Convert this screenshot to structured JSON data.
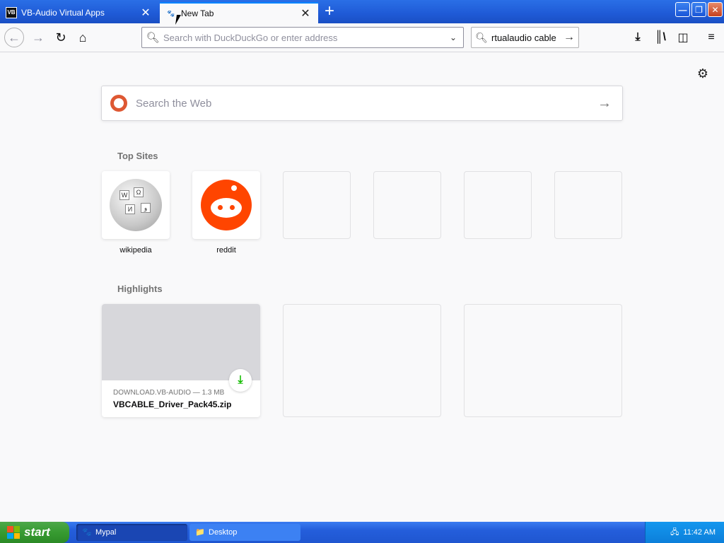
{
  "tabs": [
    {
      "title": "VB-Audio Virtual Apps",
      "favicon": "VB"
    },
    {
      "title": "New Tab"
    }
  ],
  "window_controls": {
    "minimize": "—",
    "restore": "❐",
    "close": "✕"
  },
  "navbar": {
    "url_placeholder": "Search with DuckDuckGo or enter address",
    "search_text": "rtualaudio cable"
  },
  "newtab": {
    "search_placeholder": "Search the Web",
    "top_sites_title": "Top Sites",
    "top_sites": [
      {
        "label": "wikipedia"
      },
      {
        "label": "reddit"
      },
      {
        "label": ""
      },
      {
        "label": ""
      },
      {
        "label": ""
      },
      {
        "label": ""
      }
    ],
    "highlights_title": "Highlights",
    "highlights": [
      {
        "source": "DOWNLOAD.VB-AUDIO — 1.3 MB",
        "title": "VBCABLE_Driver_Pack45.zip"
      }
    ]
  },
  "taskbar": {
    "start_label": "start",
    "items": [
      {
        "label": "Mypal"
      },
      {
        "label": "Desktop"
      }
    ],
    "clock": "11:42 AM"
  },
  "colors": {
    "accent": "#0a84ff",
    "ddg": "#de5833",
    "reddit": "#ff4500",
    "download_green": "#12bc00"
  }
}
